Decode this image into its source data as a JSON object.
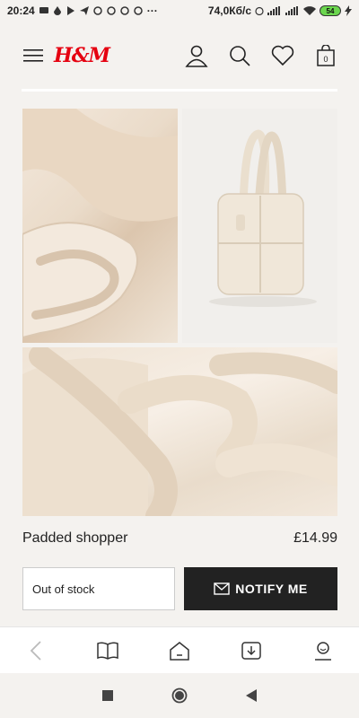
{
  "status_bar": {
    "time": "20:24",
    "network_speed": "74,0Кб/с",
    "battery": "54",
    "dots": "···"
  },
  "header": {
    "logo": "H&M"
  },
  "product": {
    "name": "Padded shopper",
    "price": "£14.99",
    "stock_status": "Out of stock",
    "notify_label": "NOTIFY ME"
  },
  "browser_bar": {
    "icons": [
      "back-icon",
      "book-icon",
      "home-icon",
      "download-icon",
      "profile-icon"
    ]
  },
  "system_nav": {
    "icons": [
      "recents-square-icon",
      "home-circle-icon",
      "back-triangle-icon"
    ]
  },
  "colors": {
    "brand_red": "#e50010",
    "button_dark": "#222222",
    "background": "#f4f2ef"
  }
}
